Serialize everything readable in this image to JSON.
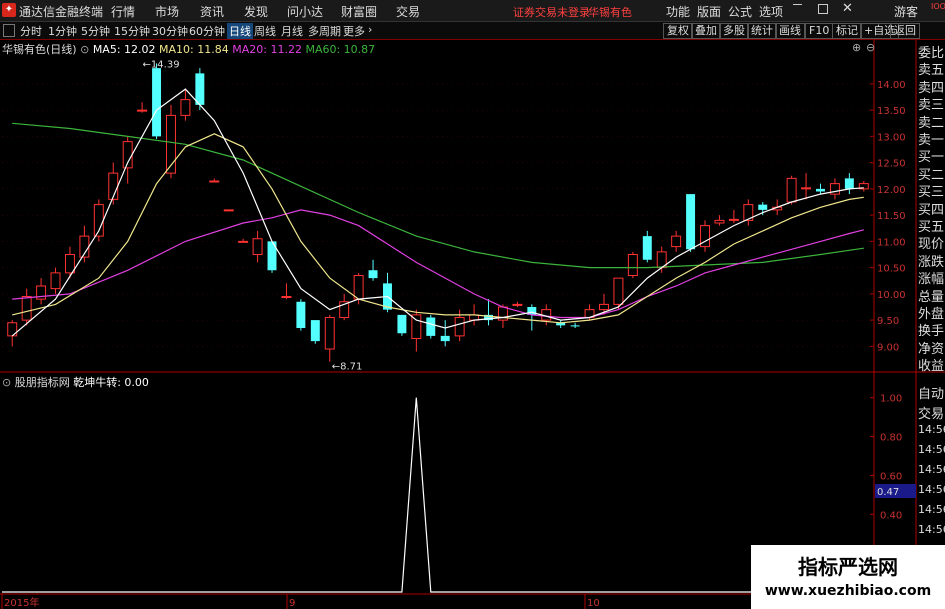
{
  "app": {
    "title": "通达信金融终端",
    "menu": [
      "行情",
      "市场",
      "资讯",
      "发现",
      "问小达",
      "财富圈",
      "交易"
    ],
    "notice": "证券交易未登录",
    "stock_name": "华锡有色",
    "right_menu": [
      "功能",
      "版面",
      "公式",
      "选项"
    ],
    "user": "游客"
  },
  "toolbar": {
    "periods": [
      "分时",
      "1分钟",
      "5分钟",
      "15分钟",
      "30分钟",
      "60分钟",
      "日线",
      "周线",
      "月线",
      "多周期",
      "更多"
    ],
    "active_period": "日线",
    "right_buttons": [
      "复权",
      "叠加",
      "多股",
      "统计",
      "画线",
      "F10",
      "标记",
      "+自选",
      "返回"
    ]
  },
  "main_header": {
    "name": "华锡有色",
    "period": "(日线)",
    "ma": [
      {
        "label": "MA5: 12.02",
        "color": "#ffffff"
      },
      {
        "label": "MA10: 11.84",
        "color": "#f0e68c"
      },
      {
        "label": "MA20: 11.22",
        "color": "#e040e0"
      },
      {
        "label": "MA60: 10.87",
        "color": "#3cb43c"
      }
    ]
  },
  "sub_header": {
    "source": "股朋指标网",
    "indicator": "乾坤牛转: 0.00"
  },
  "right_panel": {
    "top_tabs": [
      "委比",
      "卖五",
      "卖四",
      "卖三",
      "卖二",
      "卖一",
      "买一",
      "买二",
      "买三",
      "买四",
      "买五",
      "现价",
      "涨跌",
      "涨幅",
      "总量",
      "外盘",
      "换手",
      "净资",
      "收益"
    ],
    "bottom_tabs": [
      "自动",
      "交易",
      "14:56",
      "14:56",
      "14:56",
      "14:56",
      "14:56",
      "14:56",
      "14:56",
      "14:56"
    ],
    "highlight_value": "0.47"
  },
  "watermark": {
    "line1": "指标严选网",
    "line2": "www.xuezhibiao.com"
  },
  "colors": {
    "up": "#ff3232",
    "down": "#54ffff",
    "ma5": "#ffffff",
    "ma10": "#f0e68c",
    "ma20": "#e040e0",
    "ma60": "#3cb43c"
  },
  "chart_data": [
    {
      "type": "candlestick",
      "y_ticks": [
        9.0,
        9.5,
        10.0,
        10.5,
        11.0,
        11.5,
        12.0,
        12.5,
        13.0,
        13.5,
        14.0
      ],
      "ylim": [
        8.55,
        14.55
      ],
      "annotations": [
        {
          "text": "14.39",
          "value": 14.39
        },
        {
          "text": "8.71",
          "value": 8.71
        }
      ],
      "x_labels": [
        "2015年",
        "9",
        "10"
      ],
      "candles": [
        {
          "o": 9.2,
          "h": 9.5,
          "l": 9.0,
          "c": 9.45
        },
        {
          "o": 9.5,
          "h": 10.1,
          "l": 9.4,
          "c": 9.95
        },
        {
          "o": 9.9,
          "h": 10.3,
          "l": 9.8,
          "c": 10.15
        },
        {
          "o": 10.1,
          "h": 10.5,
          "l": 10.0,
          "c": 10.4
        },
        {
          "o": 10.4,
          "h": 10.9,
          "l": 10.3,
          "c": 10.75
        },
        {
          "o": 10.7,
          "h": 11.3,
          "l": 10.6,
          "c": 11.1
        },
        {
          "o": 11.1,
          "h": 11.8,
          "l": 11.0,
          "c": 11.7
        },
        {
          "o": 11.8,
          "h": 12.5,
          "l": 11.7,
          "c": 12.3
        },
        {
          "o": 12.4,
          "h": 13.0,
          "l": 12.1,
          "c": 12.9
        },
        {
          "o": 13.5,
          "h": 13.65,
          "l": 13.45,
          "c": 13.5
        },
        {
          "o": 14.3,
          "h": 14.39,
          "l": 12.95,
          "c": 13.0
        },
        {
          "o": 12.3,
          "h": 13.6,
          "l": 12.2,
          "c": 13.4
        },
        {
          "o": 13.4,
          "h": 13.9,
          "l": 13.3,
          "c": 13.7
        },
        {
          "o": 14.2,
          "h": 14.3,
          "l": 13.5,
          "c": 13.6
        },
        {
          "o": 12.15,
          "h": 12.2,
          "l": 12.15,
          "c": 12.15
        },
        {
          "o": 11.6,
          "h": 11.6,
          "l": 11.6,
          "c": 11.6
        },
        {
          "o": 11.0,
          "h": 11.05,
          "l": 11.0,
          "c": 11.0
        },
        {
          "o": 10.75,
          "h": 11.2,
          "l": 10.6,
          "c": 11.05
        },
        {
          "o": 11.0,
          "h": 11.0,
          "l": 10.4,
          "c": 10.45
        },
        {
          "o": 9.95,
          "h": 10.2,
          "l": 9.9,
          "c": 9.95
        },
        {
          "o": 9.85,
          "h": 9.9,
          "l": 9.3,
          "c": 9.35
        },
        {
          "o": 9.5,
          "h": 9.5,
          "l": 9.05,
          "c": 9.1
        },
        {
          "o": 8.95,
          "h": 9.6,
          "l": 8.71,
          "c": 9.55
        },
        {
          "o": 9.55,
          "h": 10.0,
          "l": 9.5,
          "c": 9.85
        },
        {
          "o": 9.9,
          "h": 10.4,
          "l": 9.8,
          "c": 10.35
        },
        {
          "o": 10.45,
          "h": 10.65,
          "l": 10.25,
          "c": 10.3
        },
        {
          "o": 10.2,
          "h": 10.4,
          "l": 9.65,
          "c": 9.7
        },
        {
          "o": 9.6,
          "h": 9.6,
          "l": 9.2,
          "c": 9.25
        },
        {
          "o": 9.15,
          "h": 9.7,
          "l": 8.9,
          "c": 9.6
        },
        {
          "o": 9.55,
          "h": 9.6,
          "l": 9.15,
          "c": 9.2
        },
        {
          "o": 9.2,
          "h": 9.5,
          "l": 9.0,
          "c": 9.1
        },
        {
          "o": 9.2,
          "h": 9.7,
          "l": 9.1,
          "c": 9.55
        },
        {
          "o": 9.5,
          "h": 9.8,
          "l": 9.4,
          "c": 9.6
        },
        {
          "o": 9.6,
          "h": 9.9,
          "l": 9.4,
          "c": 9.5
        },
        {
          "o": 9.5,
          "h": 9.8,
          "l": 9.35,
          "c": 9.75
        },
        {
          "o": 9.8,
          "h": 9.85,
          "l": 9.75,
          "c": 9.8
        },
        {
          "o": 9.75,
          "h": 9.8,
          "l": 9.3,
          "c": 9.6
        },
        {
          "o": 9.5,
          "h": 9.8,
          "l": 9.4,
          "c": 9.7
        },
        {
          "o": 9.45,
          "h": 9.5,
          "l": 9.35,
          "c": 9.4
        },
        {
          "o": 9.4,
          "h": 9.45,
          "l": 9.35,
          "c": 9.38
        },
        {
          "o": 9.55,
          "h": 9.8,
          "l": 9.5,
          "c": 9.7
        },
        {
          "o": 9.7,
          "h": 10.0,
          "l": 9.6,
          "c": 9.8
        },
        {
          "o": 9.8,
          "h": 10.3,
          "l": 9.7,
          "c": 10.3
        },
        {
          "o": 10.35,
          "h": 10.8,
          "l": 10.3,
          "c": 10.75
        },
        {
          "o": 11.1,
          "h": 11.2,
          "l": 10.6,
          "c": 10.65
        },
        {
          "o": 10.5,
          "h": 10.9,
          "l": 10.4,
          "c": 10.8
        },
        {
          "o": 10.9,
          "h": 11.2,
          "l": 10.8,
          "c": 11.1
        },
        {
          "o": 11.9,
          "h": 11.9,
          "l": 10.8,
          "c": 10.85
        },
        {
          "o": 10.9,
          "h": 11.4,
          "l": 10.8,
          "c": 11.3
        },
        {
          "o": 11.35,
          "h": 11.5,
          "l": 11.3,
          "c": 11.4
        },
        {
          "o": 11.4,
          "h": 11.6,
          "l": 11.35,
          "c": 11.42
        },
        {
          "o": 11.4,
          "h": 11.8,
          "l": 11.3,
          "c": 11.7
        },
        {
          "o": 11.7,
          "h": 11.75,
          "l": 11.5,
          "c": 11.6
        },
        {
          "o": 11.6,
          "h": 11.8,
          "l": 11.5,
          "c": 11.65
        },
        {
          "o": 11.75,
          "h": 12.25,
          "l": 11.7,
          "c": 12.2
        },
        {
          "o": 12.0,
          "h": 12.3,
          "l": 11.8,
          "c": 12.02
        },
        {
          "o": 12.0,
          "h": 12.1,
          "l": 11.9,
          "c": 11.95
        },
        {
          "o": 11.9,
          "h": 12.2,
          "l": 11.8,
          "c": 12.1
        },
        {
          "o": 12.2,
          "h": 12.3,
          "l": 11.9,
          "c": 12.0
        },
        {
          "o": 12.0,
          "h": 12.15,
          "l": 11.95,
          "c": 12.1
        }
      ],
      "ma": {
        "ma5": [
          [
            0,
            9.2
          ],
          [
            3,
            9.9
          ],
          [
            6,
            11.2
          ],
          [
            8,
            12.5
          ],
          [
            10,
            13.5
          ],
          [
            12,
            13.9
          ],
          [
            14,
            13.3
          ],
          [
            16,
            12.3
          ],
          [
            18,
            11.0
          ],
          [
            20,
            10.1
          ],
          [
            22,
            9.7
          ],
          [
            24,
            9.9
          ],
          [
            26,
            9.95
          ],
          [
            28,
            9.5
          ],
          [
            30,
            9.35
          ],
          [
            32,
            9.5
          ],
          [
            34,
            9.55
          ],
          [
            36,
            9.65
          ],
          [
            38,
            9.5
          ],
          [
            40,
            9.55
          ],
          [
            42,
            9.75
          ],
          [
            44,
            10.3
          ],
          [
            46,
            10.7
          ],
          [
            48,
            11.0
          ],
          [
            50,
            11.3
          ],
          [
            52,
            11.55
          ],
          [
            54,
            11.75
          ],
          [
            56,
            11.9
          ],
          [
            58,
            12.0
          ],
          [
            59,
            12.02
          ]
        ],
        "ma10": [
          [
            0,
            9.6
          ],
          [
            3,
            9.8
          ],
          [
            6,
            10.3
          ],
          [
            8,
            11.0
          ],
          [
            10,
            12.1
          ],
          [
            12,
            12.8
          ],
          [
            14,
            13.05
          ],
          [
            16,
            12.8
          ],
          [
            18,
            12.0
          ],
          [
            20,
            11.0
          ],
          [
            22,
            10.3
          ],
          [
            24,
            9.9
          ],
          [
            26,
            9.75
          ],
          [
            28,
            9.65
          ],
          [
            30,
            9.6
          ],
          [
            32,
            9.6
          ],
          [
            34,
            9.55
          ],
          [
            36,
            9.5
          ],
          [
            38,
            9.45
          ],
          [
            40,
            9.5
          ],
          [
            42,
            9.6
          ],
          [
            44,
            9.95
          ],
          [
            46,
            10.3
          ],
          [
            48,
            10.6
          ],
          [
            50,
            10.95
          ],
          [
            52,
            11.2
          ],
          [
            54,
            11.45
          ],
          [
            56,
            11.65
          ],
          [
            58,
            11.8
          ],
          [
            59,
            11.84
          ]
        ],
        "ma20": [
          [
            0,
            9.9
          ],
          [
            4,
            10.0
          ],
          [
            8,
            10.45
          ],
          [
            12,
            11.0
          ],
          [
            16,
            11.35
          ],
          [
            18,
            11.45
          ],
          [
            20,
            11.6
          ],
          [
            22,
            11.5
          ],
          [
            24,
            11.3
          ],
          [
            26,
            10.95
          ],
          [
            28,
            10.6
          ],
          [
            30,
            10.3
          ],
          [
            32,
            10.0
          ],
          [
            34,
            9.75
          ],
          [
            36,
            9.6
          ],
          [
            38,
            9.55
          ],
          [
            40,
            9.55
          ],
          [
            42,
            9.7
          ],
          [
            44,
            9.95
          ],
          [
            46,
            10.15
          ],
          [
            48,
            10.4
          ],
          [
            50,
            10.55
          ],
          [
            52,
            10.7
          ],
          [
            54,
            10.85
          ],
          [
            56,
            11.0
          ],
          [
            58,
            11.15
          ],
          [
            59,
            11.22
          ]
        ],
        "ma60": [
          [
            0,
            13.25
          ],
          [
            4,
            13.15
          ],
          [
            8,
            13.0
          ],
          [
            12,
            12.85
          ],
          [
            16,
            12.55
          ],
          [
            20,
            12.05
          ],
          [
            24,
            11.55
          ],
          [
            28,
            11.1
          ],
          [
            32,
            10.8
          ],
          [
            36,
            10.6
          ],
          [
            40,
            10.5
          ],
          [
            44,
            10.5
          ],
          [
            48,
            10.55
          ],
          [
            52,
            10.6
          ],
          [
            56,
            10.75
          ],
          [
            59,
            10.87
          ]
        ]
      }
    },
    {
      "type": "line",
      "series": [
        {
          "name": "乾坤牛转",
          "values": [
            0,
            0,
            0,
            0,
            0,
            0,
            0,
            0,
            0,
            0,
            0,
            0,
            0,
            0,
            0,
            0,
            0,
            0,
            0,
            0,
            0,
            0,
            0,
            0,
            0,
            0,
            0,
            0,
            0,
            0,
            0,
            0,
            0,
            0,
            0,
            0,
            0,
            0,
            0,
            0,
            0,
            0,
            0,
            0,
            0,
            0,
            0,
            0,
            0,
            0,
            0,
            0,
            0,
            0,
            0,
            0,
            0,
            0,
            0,
            0
          ]
        }
      ],
      "spike": {
        "x_index": 28,
        "value": 1.0
      },
      "y_ticks": [
        0.2,
        0.4,
        0.6,
        0.8,
        1.0
      ],
      "ylim": [
        0,
        1.05
      ]
    }
  ]
}
